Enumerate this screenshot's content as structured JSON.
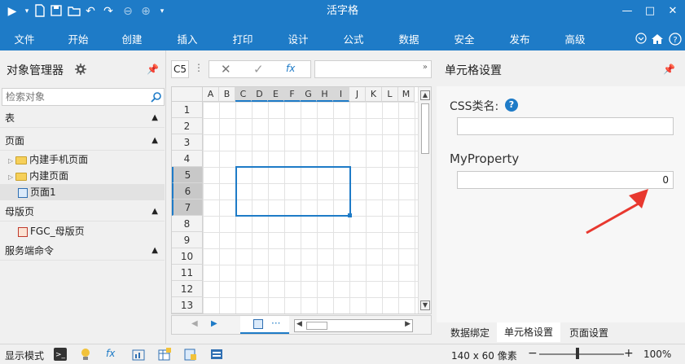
{
  "window": {
    "title": "活字格"
  },
  "ribbon": {
    "tabs": [
      "文件",
      "开始",
      "创建",
      "插入",
      "打印",
      "设计",
      "公式",
      "数据",
      "安全",
      "发布",
      "高级"
    ]
  },
  "left_panel": {
    "title": "对象管理器",
    "search_placeholder": "检索对象",
    "sections": {
      "tables": "表",
      "pages": "页面",
      "master_pages": "母版页",
      "server_commands": "服务端命令"
    },
    "tree": {
      "mobile_pages": "内建手机页面",
      "builtin_pages": "内建页面",
      "page1": "页面1",
      "master1": "FGC_母版页"
    }
  },
  "sheet": {
    "cell_ref": "C5",
    "fx_label": "fx",
    "columns": [
      "A",
      "B",
      "C",
      "D",
      "E",
      "F",
      "G",
      "H",
      "I",
      "J",
      "K",
      "L",
      "M"
    ],
    "rows": [
      "1",
      "2",
      "3",
      "4",
      "5",
      "6",
      "7",
      "8",
      "9",
      "10",
      "11",
      "12",
      "13"
    ],
    "selected_columns": [
      "C",
      "D",
      "E",
      "F",
      "G",
      "H",
      "I"
    ],
    "selected_rows": [
      "5",
      "6",
      "7"
    ],
    "more_label": "···"
  },
  "right_panel": {
    "title": "单元格设置",
    "css_label": "CSS类名:",
    "css_value": "",
    "property_label": "MyProperty",
    "property_value": "0",
    "tabs": [
      "数据绑定",
      "单元格设置",
      "页面设置"
    ],
    "active_tab": "单元格设置"
  },
  "status": {
    "mode_label": "显示模式",
    "size_text": "140 x 60 像素",
    "zoom": "100%",
    "zoom_minus": "−",
    "zoom_plus": "+"
  },
  "colors": {
    "accent": "#1e7bc7",
    "arrow": "#e8382f"
  }
}
